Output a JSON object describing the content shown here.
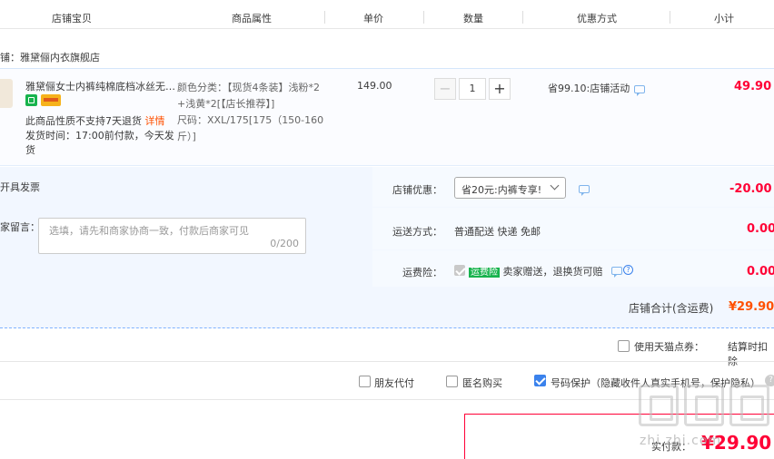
{
  "header": {
    "cols": [
      "店铺宝贝",
      "商品属性",
      "单价",
      "数量",
      "优惠方式",
      "小计"
    ]
  },
  "shop": {
    "label": "铺：雅黛俪内衣旗舰店"
  },
  "item": {
    "title": "雅黛俪女士内裤纯棉底档冰丝无…",
    "return_notice": "此商品性质不支持7天退货",
    "return_link": "详情",
    "ship_time": "发货时间：17:00前付款，今天发货",
    "attr_line1": "颜色分类：【现货4条装】浅粉*2",
    "attr_line2": "+浅黄*2[【店长推荐】]",
    "attr_line3": "尺码：XXL/175[175（150-160",
    "attr_line4": "斤）]",
    "price": "149.00",
    "qty": "1",
    "qty_minus": "−",
    "qty_plus": "+",
    "discount": "省99.10:店铺活动",
    "subtotal": "49.90"
  },
  "invoice": {
    "label": "开具发票"
  },
  "message": {
    "label": "家留言：",
    "placeholder": "选填，请先和商家协商一致，付款后商家可见",
    "counter": "0/200"
  },
  "shop_discount": {
    "label": "店铺优惠：",
    "value": "省20元:内裤专享!",
    "amount": "-20.00"
  },
  "shipping": {
    "label": "运送方式：",
    "value": "普通配送 快递 免邮",
    "amount": "0.00"
  },
  "freight_insurance": {
    "label": "运费险：",
    "badge": "运费险",
    "text": "卖家赠送，退换货可赔",
    "amount": "0.00"
  },
  "shop_total": {
    "label": "店铺合计(含运费)",
    "amount": "¥29.90"
  },
  "options": {
    "tmall_points": "使用天猫点券：",
    "settle_note": "结算时扣除",
    "friend_pay": "朋友代付",
    "anonymous": "匿名购买",
    "number_protect": "号码保护（隐藏收件人真实手机号，保护隐私）",
    "help": "?"
  },
  "pay": {
    "label": "实付款：",
    "amount": "¥29.90"
  },
  "watermark": {
    "text": "zhi.zhi.com"
  },
  "colors": {
    "accent": "#ff0036",
    "blue": "#3b82ec",
    "panel": "#f2f7ff"
  }
}
